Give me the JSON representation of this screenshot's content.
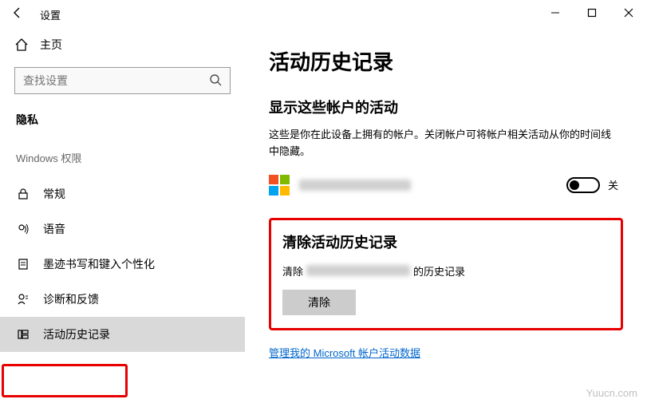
{
  "titlebar": {
    "app_title": "设置"
  },
  "home": {
    "label": "主页"
  },
  "search": {
    "placeholder": "查找设置"
  },
  "sidebar": {
    "section": "隐私",
    "group": "Windows 权限",
    "items": [
      {
        "label": "常规"
      },
      {
        "label": "语音"
      },
      {
        "label": "墨迹书写和键入个性化"
      },
      {
        "label": "诊断和反馈"
      },
      {
        "label": "活动历史记录"
      }
    ]
  },
  "page": {
    "title": "活动历史记录",
    "accounts_heading": "显示这些帐户的活动",
    "accounts_desc": "这些是你在此设备上拥有的帐户。关闭帐户可将帐户相关活动从你的时间线中隐藏。",
    "toggle_label": "关",
    "clear_heading": "清除活动历史记录",
    "clear_prefix": "清除",
    "clear_suffix": "的历史记录",
    "clear_button": "清除",
    "manage_link": "管理我的 Microsoft 帐户活动数据"
  },
  "watermark": "Yuucn.com"
}
